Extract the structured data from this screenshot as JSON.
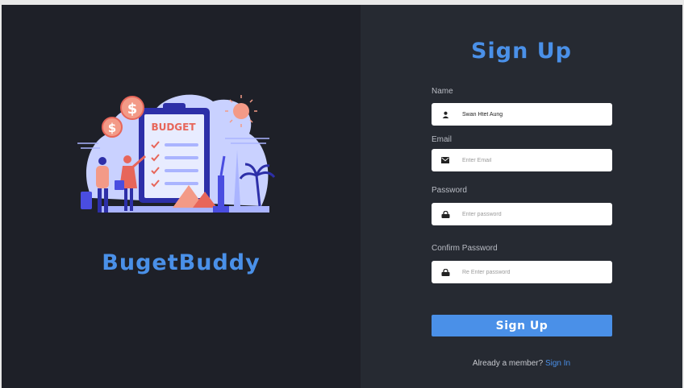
{
  "brand": {
    "name": "BugetBuddy"
  },
  "illustration": {
    "sign_text": "BUDGET",
    "coin_symbol": "$"
  },
  "form": {
    "title": "Sign Up",
    "fields": {
      "name": {
        "label": "Name",
        "value": "Swan Htet Aung",
        "placeholder": "",
        "icon": "user-icon"
      },
      "email": {
        "label": "Email",
        "value": "",
        "placeholder": "Enter Email",
        "icon": "envelope-icon"
      },
      "password": {
        "label": "Password",
        "value": "",
        "placeholder": "Enter password",
        "icon": "lock-icon"
      },
      "confirm_password": {
        "label": "Confirm Password",
        "value": "",
        "placeholder": "Re Enter password",
        "icon": "lock-icon"
      }
    },
    "submit_label": "Sign Up",
    "footer_text": "Already a member?",
    "signin_link": "Sign In"
  },
  "colors": {
    "left_panel": "#1e2028",
    "right_panel": "#262a32",
    "accent": "#4a90e8",
    "input_bg": "#ffffff"
  }
}
